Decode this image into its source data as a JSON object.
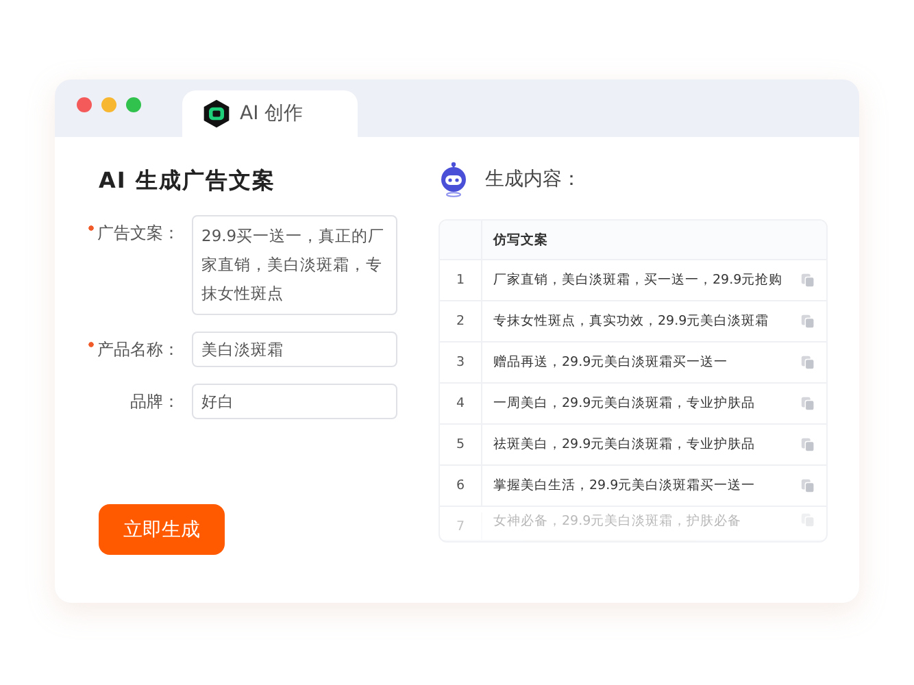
{
  "window": {
    "tab": {
      "label": "AI 创作",
      "selected": true
    }
  },
  "form": {
    "title": "AI 生成广告文案",
    "fields": [
      {
        "label": "广告文案：",
        "required": true,
        "kind": "textarea",
        "value": "29.9买一送一，真正的厂家直销，美白淡斑霜，专抹女性斑点"
      },
      {
        "label": "产品名称：",
        "required": true,
        "kind": "input",
        "value": "美白淡斑霜"
      },
      {
        "label": "品牌：",
        "required": false,
        "kind": "input",
        "value": "好白"
      }
    ],
    "submit_button": "立即生成"
  },
  "results": {
    "title": "生成内容：",
    "table": {
      "columns": [
        "",
        "仿写文案"
      ],
      "rows": [
        {
          "index": "1",
          "text": "厂家直销，美白淡斑霜，买一送一，29.9元抢购",
          "faded": false
        },
        {
          "index": "2",
          "text": "专抹女性斑点，真实功效，29.9元美白淡斑霜",
          "faded": false
        },
        {
          "index": "3",
          "text": "赠品再送，29.9元美白淡斑霜买一送一",
          "faded": false
        },
        {
          "index": "4",
          "text": "一周美白，29.9元美白淡斑霜，专业护肤品",
          "faded": false
        },
        {
          "index": "5",
          "text": "祛斑美白，29.9元美白淡斑霜，专业护肤品",
          "faded": false
        },
        {
          "index": "6",
          "text": "掌握美白生活，29.9元美白淡斑霜买一送一",
          "faded": false
        },
        {
          "index": "7",
          "text": "女神必备，29.9元美白淡斑霜，护肤必备",
          "faded": true
        }
      ]
    }
  }
}
